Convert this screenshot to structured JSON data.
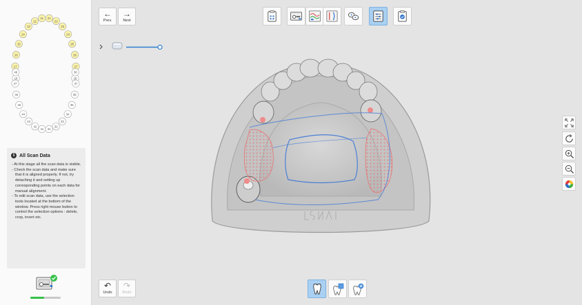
{
  "toolbar": {
    "prev_label": "Prev.",
    "next_label": "Next",
    "tools": [
      {
        "icon": "scan-data-icon"
      },
      {
        "icon": "detach-data-icon"
      },
      {
        "icon": "align-data-icon"
      },
      {
        "icon": "compare-data-icon"
      },
      {
        "icon": "link-icon"
      },
      {
        "icon": "sliders-icon",
        "active": true
      },
      {
        "icon": "complete-icon"
      }
    ]
  },
  "tooth_chart": {
    "upper": [
      "18",
      "17",
      "16",
      "15",
      "14",
      "13",
      "12",
      "11",
      "21",
      "22",
      "23",
      "24",
      "25",
      "26",
      "27",
      "28"
    ],
    "lower": [
      "48",
      "47",
      "46",
      "45",
      "44",
      "43",
      "42",
      "41",
      "31",
      "32",
      "33",
      "34",
      "35",
      "36",
      "37",
      "38"
    ]
  },
  "info": {
    "title": "All Scan Data",
    "items": [
      "At this stage all the scan data is visible.",
      "Check the scan data and make sure that it is aligned properly. If not, try detaching it and setting up corresponding points on each data for manual alignment.",
      "To edit scan data, use the selection tools located at the bottom of the window. Press right mouse button to control the selection options : delete, crop, invert etc."
    ]
  },
  "progress": {
    "fraction": 0.45,
    "color": "#35c24a"
  },
  "slider": {
    "value": 1.0,
    "color": "#2e7fd0"
  },
  "right_tools": [
    {
      "icon": "fit-to-screen-icon"
    },
    {
      "icon": "rotate-icon"
    },
    {
      "icon": "zoom-in-icon"
    },
    {
      "icon": "zoom-out-icon"
    },
    {
      "icon": "color-wheel-icon"
    }
  ],
  "bottom": {
    "undo_label": "Undo",
    "redo_label": "Redo",
    "views": [
      {
        "icon": "tooth-view-icon",
        "active": true
      },
      {
        "icon": "tooth-selection-icon"
      },
      {
        "icon": "tooth-settings-icon"
      }
    ]
  },
  "colors": {
    "accent": "#a9d0f2",
    "background": "#e4e4e4",
    "margin_line": "#4a7fd6",
    "highlight": "#e97070"
  }
}
